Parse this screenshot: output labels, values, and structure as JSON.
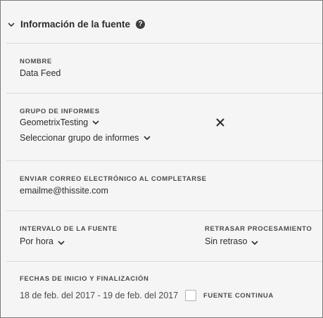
{
  "section": {
    "title": "Información de la fuente",
    "help_symbol": "?"
  },
  "name": {
    "label": "NOMBRE",
    "value": "Data Feed"
  },
  "report_suite": {
    "label": "GRUPO DE INFORMES",
    "selected": "GeometrixTesting",
    "select_prompt": "Seleccionar grupo de informes"
  },
  "email": {
    "label": "ENVIAR CORREO ELECTRÓNICO AL COMPLETARSE",
    "value": "emailme@thissite.com"
  },
  "interval": {
    "label": "INTERVALO DE LA FUENTE",
    "value": "Por hora"
  },
  "delay": {
    "label": "RETRASAR PROCESAMIENTO",
    "value": "Sin retraso"
  },
  "dates": {
    "label": "FECHAS DE INICIO Y FINALIZACIÓN",
    "range": "18 de feb. del 2017 - 19 de feb. del 2017",
    "continuous_label": "FUENTE CONTINUA",
    "continuous_checked": false
  },
  "icons": [
    "chevron-down-icon",
    "help-icon",
    "close-icon",
    "checkbox"
  ]
}
